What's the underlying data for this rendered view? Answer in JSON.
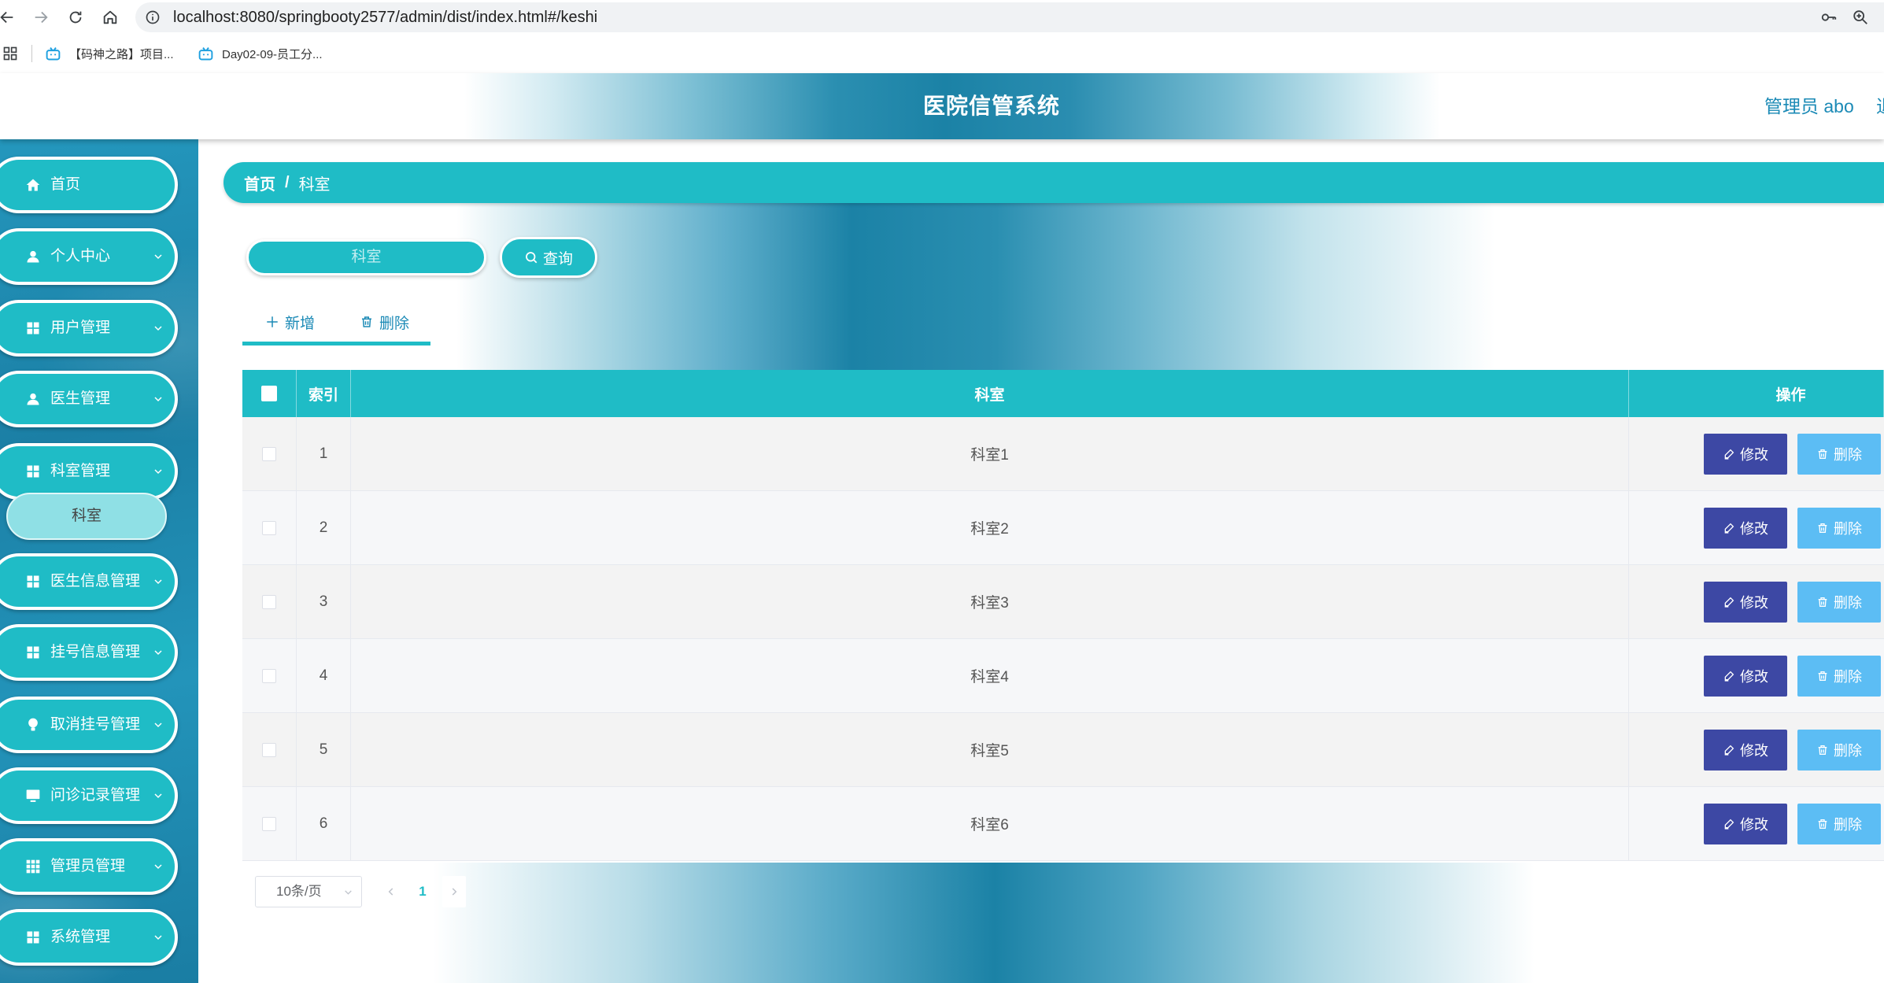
{
  "browser": {
    "url": "localhost:8080/springbooty2577/admin/dist/index.html#/keshi",
    "bookmarks": [
      {
        "label": "【码神之路】项目...",
        "icon": "bilibili-icon"
      },
      {
        "label": "Day02-09-员工分...",
        "icon": "bilibili-icon"
      }
    ]
  },
  "header": {
    "title": "医院信管系统",
    "user": "管理员 abo",
    "logout_partial": "退"
  },
  "sidebar": {
    "items": [
      {
        "label": "首页",
        "icon": "home-icon"
      },
      {
        "label": "个人中心",
        "icon": "user-icon"
      },
      {
        "label": "用户管理",
        "icon": "grid-icon"
      },
      {
        "label": "医生管理",
        "icon": "user-icon"
      },
      {
        "label": "科室管理",
        "icon": "grid-icon",
        "expanded": true,
        "children": [
          {
            "label": "科室",
            "active": true
          }
        ]
      },
      {
        "label": "医生信息管理",
        "icon": "grid-icon"
      },
      {
        "label": "挂号信息管理",
        "icon": "grid-icon"
      },
      {
        "label": "取消挂号管理",
        "icon": "bulb-icon"
      },
      {
        "label": "问诊记录管理",
        "icon": "monitor-icon"
      },
      {
        "label": "管理员管理",
        "icon": "apps-grid-icon"
      },
      {
        "label": "系统管理",
        "icon": "grid-icon"
      }
    ]
  },
  "breadcrumb": {
    "home": "首页",
    "separator": "/",
    "current": "科室"
  },
  "search": {
    "placeholder": "科室",
    "value": "",
    "button_label": "查询"
  },
  "toolbar": {
    "add_label": "新增",
    "delete_label": "删除"
  },
  "table": {
    "columns": {
      "index": "索引",
      "name": "科室",
      "actions": "操作"
    },
    "rows": [
      {
        "index": "1",
        "name": "科室1"
      },
      {
        "index": "2",
        "name": "科室2"
      },
      {
        "index": "3",
        "name": "科室3"
      },
      {
        "index": "4",
        "name": "科室4"
      },
      {
        "index": "5",
        "name": "科室5"
      },
      {
        "index": "6",
        "name": "科室6"
      }
    ],
    "edit_label": "修改",
    "delete_label": "删除"
  },
  "pagination": {
    "page_size": "10条/页",
    "current_page": "1"
  },
  "colors": {
    "primary": "#1fbcc6",
    "header_dark": "#1b82a6",
    "edit_button": "#3d48a4",
    "delete_button": "#5cbdf4",
    "submenu_active": "#8fe0e5",
    "accent_text": "#1b8ab6"
  }
}
